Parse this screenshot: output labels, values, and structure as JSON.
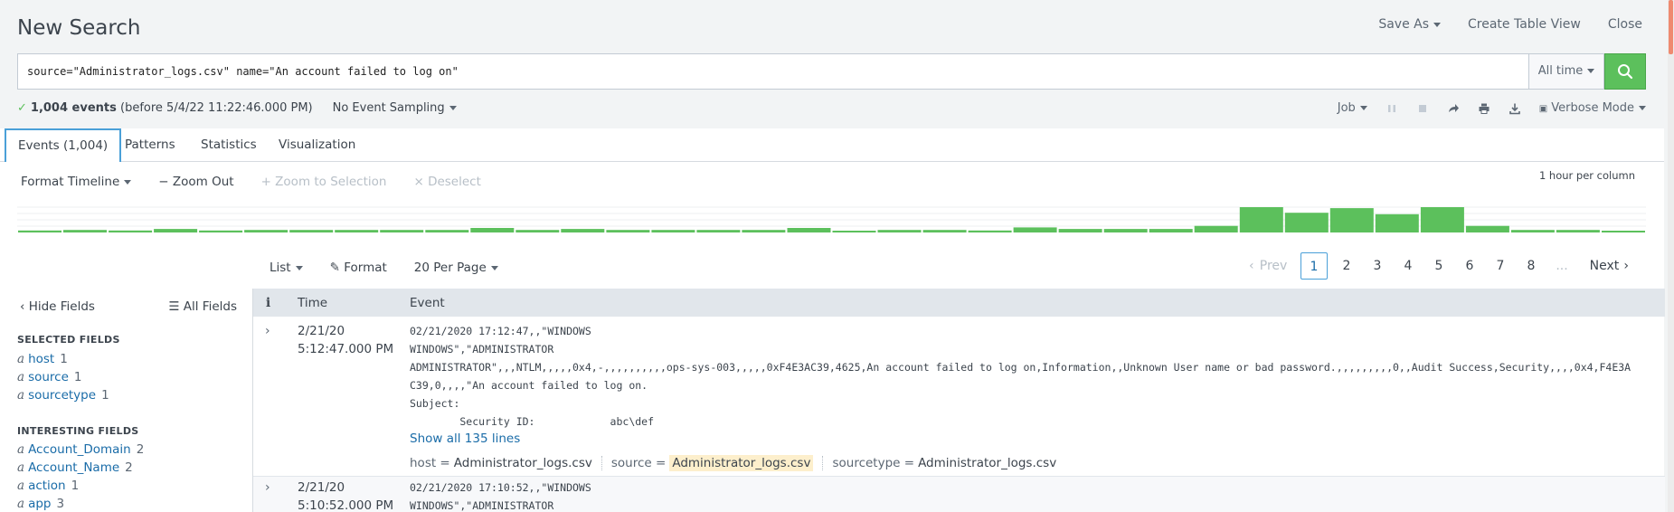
{
  "header": {
    "title": "New Search",
    "actions": [
      "Save As",
      "Create Table View",
      "Close"
    ]
  },
  "search": {
    "query": "source=\"Administrator_logs.csv\" name=\"An account failed to log on\"",
    "time_range": "All time",
    "search_icon": "search-icon"
  },
  "status": {
    "events_count": "1,004 events",
    "before": "(before 5/4/22 11:22:46.000 PM)",
    "sampling": "No Event Sampling",
    "job": "Job",
    "mode": "Verbose Mode"
  },
  "tabs": [
    {
      "label": "Events (1,004)",
      "active": true
    },
    {
      "label": "Patterns"
    },
    {
      "label": "Statistics"
    },
    {
      "label": "Visualization"
    }
  ],
  "timeline": {
    "format_label": "Format Timeline",
    "zoom_out": "Zoom Out",
    "zoom_selection": "Zoom to Selection",
    "deselect": "Deselect",
    "per_column": "1 hour per column",
    "bar_color": "#5cc05c",
    "bars": [
      0.08,
      0.1,
      0.08,
      0.14,
      0.08,
      0.1,
      0.1,
      0.1,
      0.1,
      0.1,
      0.18,
      0.1,
      0.14,
      0.1,
      0.1,
      0.1,
      0.1,
      0.18,
      0.06,
      0.1,
      0.1,
      0.08,
      0.2,
      0.14,
      0.14,
      0.14,
      0.26,
      1.0,
      0.78,
      0.96,
      0.72,
      1.0,
      0.26,
      0.1,
      0.1,
      0.04
    ]
  },
  "results_toolbar": {
    "list": "List",
    "format": "Format",
    "per_page": "20 Per Page",
    "prev": "Prev",
    "pages": [
      "1",
      "2",
      "3",
      "4",
      "5",
      "6",
      "7",
      "8",
      "..."
    ],
    "next": "Next"
  },
  "sidebar": {
    "hide_fields": "Hide Fields",
    "all_fields": "All Fields",
    "selected_heading": "SELECTED FIELDS",
    "selected": [
      {
        "name": "host",
        "count": "1"
      },
      {
        "name": "source",
        "count": "1"
      },
      {
        "name": "sourcetype",
        "count": "1"
      }
    ],
    "interesting_heading": "INTERESTING FIELDS",
    "interesting": [
      {
        "name": "Account_Domain",
        "count": "2"
      },
      {
        "name": "Account_Name",
        "count": "2"
      },
      {
        "name": "action",
        "count": "1"
      },
      {
        "name": "app",
        "count": "3"
      }
    ]
  },
  "events_table": {
    "col_info": "i",
    "col_time": "Time",
    "col_event": "Event",
    "rows": [
      {
        "date": "2/21/20",
        "time": "5:12:47.000 PM",
        "lines": [
          "02/21/2020 17:12:47,,\"WINDOWS",
          "WINDOWS\",\"ADMINISTRATOR",
          "ADMINISTRATOR\",,,NTLM,,,,,0x4,-,,,,,,,,,,ops-sys-003,,,,,0xF4E3AC39,4625,An account failed to log on,Information,,Unknown User name or bad password.,,,,,,,,,0,,Audit Success,Security,,,,0x4,F4E3A",
          "C39,0,,,,\"An account failed to log on.",
          "Subject:",
          "        Security ID:            abc\\def"
        ],
        "show_all": "Show all 135 lines",
        "host": "Administrator_logs.csv",
        "source": "Administrator_logs.csv",
        "sourcetype": "Administrator_logs.csv"
      },
      {
        "date": "2/21/20",
        "time": "5:10:52.000 PM",
        "lines": [
          "02/21/2020 17:10:52,,\"WINDOWS",
          "WINDOWS\",\"ADMINISTRATOR"
        ]
      }
    ]
  },
  "tag_labels": {
    "host": "host =",
    "source": "source =",
    "sourcetype": "sourcetype ="
  }
}
